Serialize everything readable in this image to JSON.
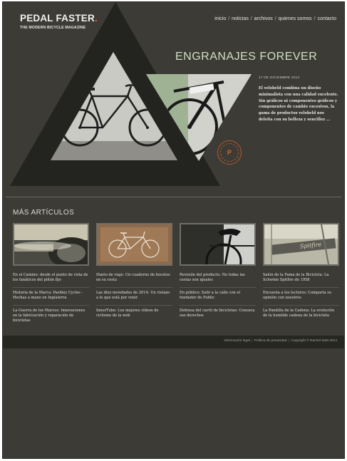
{
  "brand": {
    "name_word1": "PEDAL",
    "name_word2": "FASTER",
    "name_dot": ".",
    "tagline": "THE MODERN BICYCLE MAGAZINE",
    "accent_color": "#d4692f"
  },
  "nav": {
    "items": [
      "inicio",
      "noticias",
      "archivos",
      "quienes somos",
      "contacto"
    ],
    "separator": "/"
  },
  "hero": {
    "title": "ENGRANAJES FOREVER",
    "date": "17 DE DICIEMBRE 2014",
    "description": "El velobeld combina un diseño minimalista con una calidad excelente. Sin gráficos ni componentes gráficos y componentes de cambio excesivos, la gama de productos velobeld nos deleita con su belleza y sencillez ...",
    "badge_icon": "pedal-faster-badge-icon",
    "badge_letter": "P"
  },
  "more_articles": {
    "title": "MÁS ARTÍCULOS",
    "columns": [
      {
        "thumb_icon": "wheel-photo-thumbnail",
        "articles": [
          "En el Camino: desde el punto de vista de los fanáticos del piñón fijo",
          "Historia de la Marca: Pashley Cycles - Hechas a mano en Inglaterra",
          "La Guerra de los Marcos: Innovaciones en la fabricación y reparación de bicicletas"
        ]
      },
      {
        "thumb_icon": "bicycle-sketch-thumbnail",
        "articles": [
          "Diario de viaje: Un cuaderno de bocetos en su cesta",
          "Las diez novedades de 2014: Un vistazo a lo que está por venir",
          "InnerTube: Los mejores vídeos de ciclismo de la web"
        ]
      },
      {
        "thumb_icon": "bicycle-seat-thumbnail",
        "articles": [
          "Revisión del producto: No todas las cestas son iguales",
          "En público: Salir a la calle con el fundador de Public",
          "Defensa del carril de bicicletas: Conozca sus derechos"
        ]
      },
      {
        "thumb_icon": "bicycle-frame-thumbnail",
        "articles": [
          "Salón de la Fama de la Bicicleta: La Schwinn Spitfire de 1958",
          "Encuesta a los lectores: Comparta su opinión con nosotros",
          "La Pandilla de la Cadena: La evolución de la humilde cadena de la bicicleta"
        ]
      }
    ]
  },
  "footer": {
    "links": [
      "Información legal",
      "Política de privacidad",
      "Copyright © Rachel Watt 2014"
    ],
    "separator": "|"
  }
}
